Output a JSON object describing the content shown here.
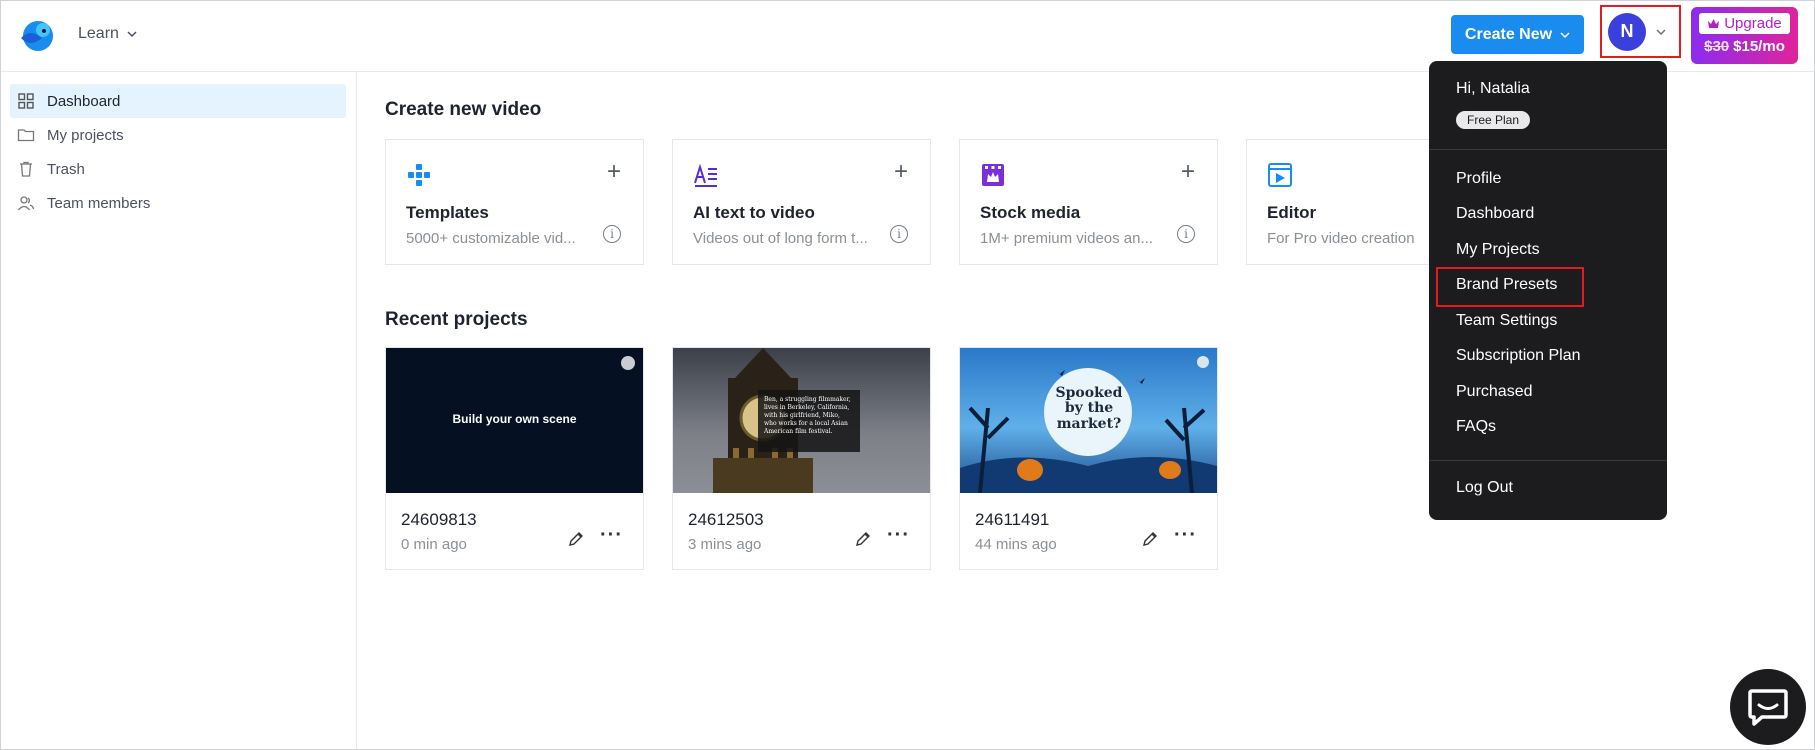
{
  "header": {
    "learn_label": "Learn",
    "create_new_label": "Create New",
    "avatar_initial": "N",
    "upgrade": {
      "label": "Upgrade",
      "old_price": "$30",
      "new_price": "$15/mo"
    }
  },
  "sidebar": {
    "items": [
      {
        "label": "Dashboard",
        "icon": "grid-icon",
        "active": true
      },
      {
        "label": "My projects",
        "icon": "folder-icon"
      },
      {
        "label": "Trash",
        "icon": "trash-icon"
      },
      {
        "label": "Team members",
        "icon": "team-icon"
      }
    ]
  },
  "create_section": {
    "title": "Create new video",
    "cards": [
      {
        "title": "Templates",
        "desc": "5000+ customizable vid...",
        "icon": "templates-icon"
      },
      {
        "title": "AI text to video",
        "desc": "Videos out of long form t...",
        "icon": "ai-text-icon"
      },
      {
        "title": "Stock media",
        "desc": "1M+ premium videos an...",
        "icon": "stock-media-icon"
      },
      {
        "title": "Editor",
        "desc": "For Pro video creation",
        "icon": "editor-icon"
      }
    ]
  },
  "recent_section": {
    "title": "Recent projects",
    "projects": [
      {
        "name": "24609813",
        "time": "0 min ago",
        "thumb_text": "Build your own scene"
      },
      {
        "name": "24612503",
        "time": "3 mins ago",
        "thumb_text": "Ben, a struggling filmmaker, lives in Berkeley, California, with his girlfriend, Miko, who works for a local Asian American film festival."
      },
      {
        "name": "24611491",
        "time": "44 mins ago",
        "thumb_text": "Spooked by the market?"
      }
    ]
  },
  "dropdown": {
    "greeting": "Hi, Natalia",
    "plan_badge": "Free Plan",
    "items": [
      "Profile",
      "Dashboard",
      "My Projects",
      "Brand Presets",
      "Team Settings",
      "Subscription Plan",
      "Purchased",
      "FAQs"
    ],
    "logout": "Log Out"
  }
}
